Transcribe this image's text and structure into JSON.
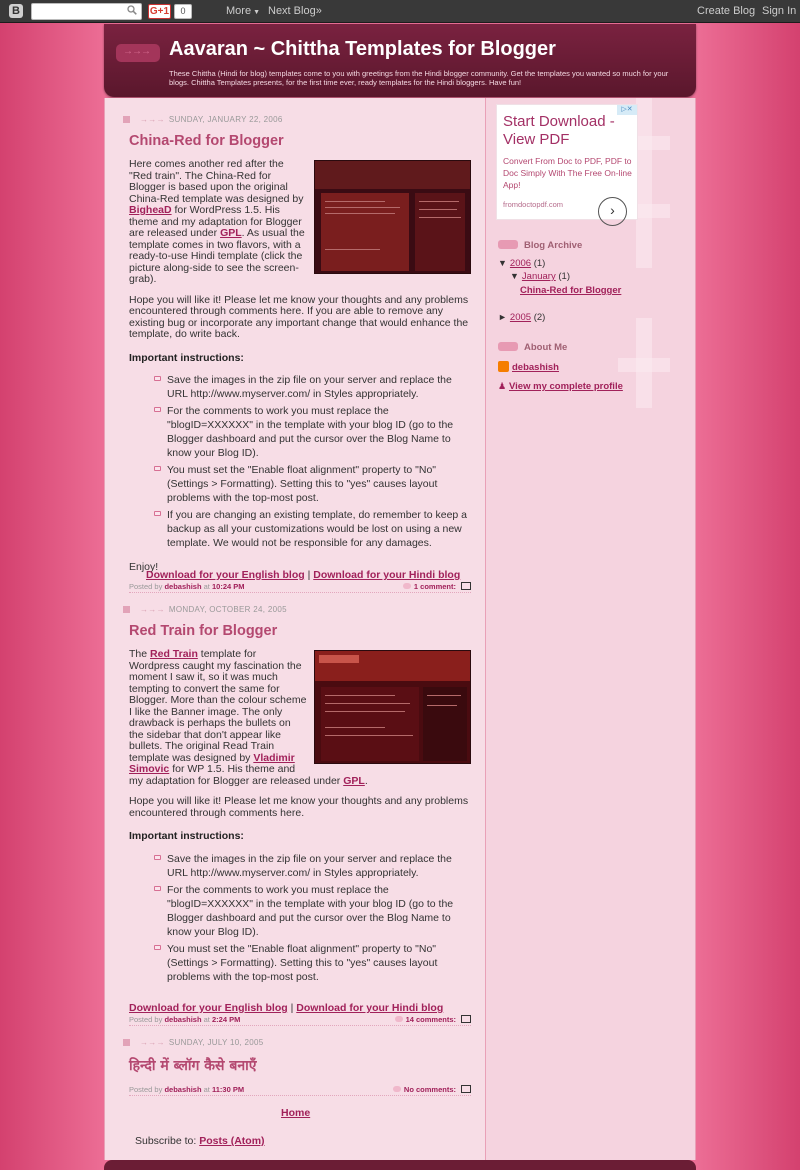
{
  "navbar": {
    "logo": "B",
    "gplus_label": "G+1",
    "gplus_count": "0",
    "more_label": "More",
    "next_label": "Next Blog»",
    "create_label": "Create Blog",
    "signin_label": "Sign In"
  },
  "header": {
    "title": "Aavaran ~ Chittha Templates for Blogger",
    "arrow": "→→→",
    "description": "These Chittha (Hindi for blog) templates come to you with greetings from the Hindi blogger community. Get the templates you wanted so much for your blogs. Chittha Templates presents, for the first time ever, ready templates for the Hindi bloggers. Have fun!"
  },
  "posts": [
    {
      "date": "SUNDAY, JANUARY 22, 2006",
      "title": "China-Red for Blogger",
      "intro_1": "Here comes another red after the \"Red train\". The China-Red for Blogger is based upon the original China-Red template was designed by ",
      "intro_link_1": "BigheaD",
      "intro_2": " for WordPress 1.5. His theme and my adaptation for Blogger are released under ",
      "intro_link_2": "GPL",
      "intro_3": ". As usual the template comes in two flavors, with a ready-to-use Hindi template (click the picture along-side to see the screen-grab).",
      "para_2": "Hope you will like it! Please let me know your thoughts and any problems encountered through comments here. If you are able to remove any existing bug or incorporate any important change that would enhance the template, do write back.",
      "instructions_title": "Important instructions:",
      "instructions": [
        "Save the images in the zip file on your server and replace the URL http://www.myserver.com/ in Styles appropriately.",
        "For the comments to work you must replace the \"blogID=XXXXXX\" in the template with your blog ID (go to the Blogger dashboard and put the cursor over the Blog Name to know your Blog ID).",
        "You must set the \"Enable float alignment\" property to \"No\" (Settings > Formatting). Setting this to \"yes\" causes layout problems with the top-most post.",
        "If you are changing an existing template, do remember to keep a backup as all your customizations would be lost on using a new template. We would not be responsible for any damages."
      ],
      "closing": "Enjoy!",
      "download_english": "Download for your English blog",
      "separator": "|",
      "download_hindi": "Download for your Hindi blog",
      "posted_by": "Posted by",
      "author": "debashish",
      "at": "at",
      "time": "10:24 PM",
      "comments": "1 comment:"
    },
    {
      "date": "MONDAY, OCTOBER 24, 2005",
      "title": "Red Train for Blogger",
      "intro_1": "The ",
      "intro_link_1": "Red Train",
      "intro_2": " template for Wordpress caught my fascination the moment I saw it, so it was much tempting to convert the same for Blogger. More than the colour scheme I like the Banner image. The only drawback is perhaps the bullets on the sidebar that don't appear like bullets. The original Read Train template was designed by ",
      "intro_link_2": "Vladimir Simovic",
      "intro_3": " for WP 1.5. His theme and my adaptation for Blogger are released under ",
      "intro_link_3": "GPL",
      "intro_4": ".",
      "para_2": "Hope you will like it! Please let me know your thoughts and any problems encountered through comments here.",
      "instructions_title": "Important instructions:",
      "instructions": [
        "Save the images in the zip file on your server and replace the URL http://www.myserver.com/ in Styles appropriately.",
        "For the comments to work you must replace the \"blogID=XXXXXX\" in the template with your blog ID (go to the Blogger dashboard and put the cursor over the Blog Name to know your Blog ID).",
        "You must set the \"Enable float alignment\" property to \"No\" (Settings > Formatting). Setting this to \"yes\" causes layout problems with the top-most post."
      ],
      "download_english": "Download for your English blog",
      "separator": "|",
      "download_hindi": "Download for your Hindi blog",
      "posted_by": "Posted by",
      "author": "debashish",
      "at": "at",
      "time": "2:24 PM",
      "comments": "14 comments:"
    },
    {
      "date": "SUNDAY, JULY 10, 2005",
      "title": "हिन्दी में ब्लॉग कैसे बनाएँ",
      "posted_by": "Posted by",
      "author": "debashish",
      "at": "at",
      "time": "11:30 PM",
      "comments": "No comments:"
    }
  ],
  "home_label": "Home",
  "subscribe_label": "Subscribe to:",
  "subscribe_link": "Posts (Atom)",
  "ad": {
    "title": "Start Download - View PDF",
    "body": "Convert From Doc to PDF, PDF to Doc Simply With The Free On-line App!",
    "domain": "fromdoctopdf.com",
    "go": "›",
    "adchoices": "▷✕"
  },
  "sidebar": {
    "archive_title": "Blog Archive",
    "archive": [
      {
        "toggle": "▼",
        "label": "2006",
        "count": "(1)"
      },
      {
        "toggle": "▼",
        "label": "January",
        "count": "(1)"
      },
      {
        "label": "China-Red for Blogger"
      },
      {
        "toggle": "►",
        "label": "2005",
        "count": "(2)"
      }
    ],
    "about_title": "About Me",
    "author": "debashish",
    "profile_link": "View my complete profile"
  }
}
